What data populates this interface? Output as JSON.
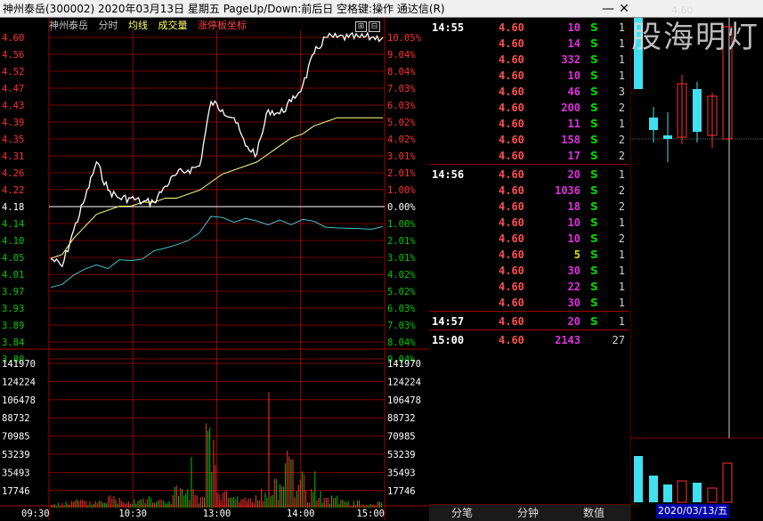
{
  "window": {
    "title": "神州泰岳(300002)  2020年03月13日  星期五  PageUp/Down:前后日  空格键:操作  通达信(R)",
    "min_icon": "minimize-icon",
    "close_icon": "close-icon"
  },
  "menu": {
    "stock_name": "神州泰岳",
    "time_share": "分时",
    "avg_line": "均线",
    "volume": "成交量",
    "limit_up": "涨停板坐标"
  },
  "colors": {
    "up": "#ff3030",
    "down": "#00c800",
    "price": "#ffffff",
    "avg": "#ffff80",
    "ref": "#ffffff",
    "grid": "#b00000",
    "vol_label": "#ffffff"
  },
  "price_axis": {
    "left_ticks": [
      "4.60",
      "4.56",
      "4.52",
      "4.47",
      "4.43",
      "4.39",
      "4.35",
      "4.31",
      "4.26",
      "4.22",
      "4.18",
      "4.14",
      "4.10",
      "4.05",
      "4.01",
      "3.97",
      "3.93",
      "3.89",
      "3.84",
      "3.80"
    ],
    "right_ticks": [
      "10.05%",
      "9.04%",
      "8.04%",
      "7.03%",
      "6.03%",
      "5.02%",
      "4.02%",
      "3.01%",
      "2.01%",
      "1.00%",
      "0.00%",
      "1.00%",
      "2.01%",
      "3.01%",
      "4.02%",
      "5.02%",
      "6.03%",
      "7.03%",
      "8.04%",
      "9.04%"
    ],
    "ref_price": "4.18"
  },
  "volume_axis": {
    "ticks": [
      "141970",
      "124224",
      "106478",
      "88732",
      "70985",
      "53239",
      "35493",
      "17746"
    ]
  },
  "time_axis": {
    "ticks": [
      "09:30",
      "10:30",
      "13:00",
      "14:00",
      "15:00"
    ]
  },
  "chart_data": {
    "type": "line",
    "title": "",
    "series": [
      {
        "values": [
          4.05,
          4.03,
          4.12,
          4.2,
          4.29,
          4.22,
          4.2,
          4.2,
          4.19,
          4.19,
          4.23,
          4.26,
          4.27,
          4.28,
          4.44,
          4.42,
          4.4,
          4.33,
          4.31,
          4.42,
          4.41,
          4.44,
          4.48,
          4.56,
          4.6,
          4.6,
          4.6,
          4.6,
          4.6,
          4.6
        ]
      },
      {
        "values": [
          4.05,
          4.06,
          4.1,
          4.13,
          4.16,
          4.17,
          4.18,
          4.18,
          4.19,
          4.19,
          4.2,
          4.2,
          4.21,
          4.22,
          4.24,
          4.26,
          4.27,
          4.28,
          4.29,
          4.31,
          4.33,
          4.35,
          4.36,
          4.38,
          4.39,
          4.4,
          4.4,
          4.4,
          4.4,
          4.4
        ]
      },
      {
        "values": [
          2,
          3,
          4,
          3,
          4,
          6,
          5,
          5,
          6,
          4,
          4,
          10,
          8,
          6,
          35,
          8,
          6,
          5,
          6,
          8,
          12,
          30,
          15,
          8,
          7,
          5,
          4,
          3,
          2,
          3
        ]
      }
    ],
    "x": [
      "09:30",
      "09:38",
      "09:46",
      "09:54",
      "10:02",
      "10:10",
      "10:18",
      "10:26",
      "10:34",
      "10:42",
      "10:50",
      "10:58",
      "11:06",
      "11:14",
      "13:00",
      "13:08",
      "13:16",
      "13:24",
      "13:32",
      "13:40",
      "13:48",
      "13:56",
      "14:04",
      "14:12",
      "14:20",
      "14:28",
      "14:36",
      "14:44",
      "14:52",
      "15:00"
    ],
    "ylim_price": [
      3.8,
      4.6
    ],
    "ylim_volume": [
      0,
      141970
    ]
  },
  "ticks_panel": {
    "rows": [
      {
        "time": "14:55",
        "price": "4.60",
        "vol": "10",
        "bs": "S",
        "n": "1",
        "vcolor": "#e030e0"
      },
      {
        "time": "",
        "price": "4.60",
        "vol": "14",
        "bs": "S",
        "n": "1",
        "vcolor": "#e030e0"
      },
      {
        "time": "",
        "price": "4.60",
        "vol": "332",
        "bs": "S",
        "n": "1",
        "vcolor": "#e030e0"
      },
      {
        "time": "",
        "price": "4.60",
        "vol": "10",
        "bs": "S",
        "n": "1",
        "vcolor": "#e030e0"
      },
      {
        "time": "",
        "price": "4.60",
        "vol": "46",
        "bs": "S",
        "n": "3",
        "vcolor": "#e030e0"
      },
      {
        "time": "",
        "price": "4.60",
        "vol": "200",
        "bs": "S",
        "n": "2",
        "vcolor": "#e030e0"
      },
      {
        "time": "",
        "price": "4.60",
        "vol": "11",
        "bs": "S",
        "n": "1",
        "vcolor": "#e030e0"
      },
      {
        "time": "",
        "price": "4.60",
        "vol": "158",
        "bs": "S",
        "n": "2",
        "vcolor": "#e030e0"
      },
      {
        "time": "",
        "price": "4.60",
        "vol": "17",
        "bs": "S",
        "n": "2",
        "vcolor": "#e030e0"
      },
      {
        "time": "14:56",
        "price": "4.60",
        "vol": "20",
        "bs": "S",
        "n": "1",
        "vcolor": "#e030e0"
      },
      {
        "time": "",
        "price": "4.60",
        "vol": "1036",
        "bs": "S",
        "n": "2",
        "vcolor": "#e030e0"
      },
      {
        "time": "",
        "price": "4.60",
        "vol": "18",
        "bs": "S",
        "n": "2",
        "vcolor": "#e030e0"
      },
      {
        "time": "",
        "price": "4.60",
        "vol": "10",
        "bs": "S",
        "n": "1",
        "vcolor": "#e030e0"
      },
      {
        "time": "",
        "price": "4.60",
        "vol": "10",
        "bs": "S",
        "n": "2",
        "vcolor": "#e030e0"
      },
      {
        "time": "",
        "price": "4.60",
        "vol": "5",
        "bs": "S",
        "n": "1",
        "vcolor": "#e0e000"
      },
      {
        "time": "",
        "price": "4.60",
        "vol": "30",
        "bs": "S",
        "n": "1",
        "vcolor": "#e030e0"
      },
      {
        "time": "",
        "price": "4.60",
        "vol": "22",
        "bs": "S",
        "n": "1",
        "vcolor": "#e030e0"
      },
      {
        "time": "",
        "price": "4.60",
        "vol": "30",
        "bs": "S",
        "n": "1",
        "vcolor": "#e030e0"
      },
      {
        "time": "14:57",
        "price": "4.60",
        "vol": "20",
        "bs": "S",
        "n": "1",
        "vcolor": "#e030e0"
      },
      {
        "time": "15:00",
        "price": "4.60",
        "vol": "2143",
        "bs": "",
        "n": "27",
        "vcolor": "#e030e0"
      }
    ]
  },
  "bottom_tabs": [
    "分笔",
    "分钟",
    "数值"
  ],
  "kline_panel": {
    "watermark": "股海明灯",
    "high_label": "4.60",
    "date_badge": "2020/03/13/五"
  }
}
